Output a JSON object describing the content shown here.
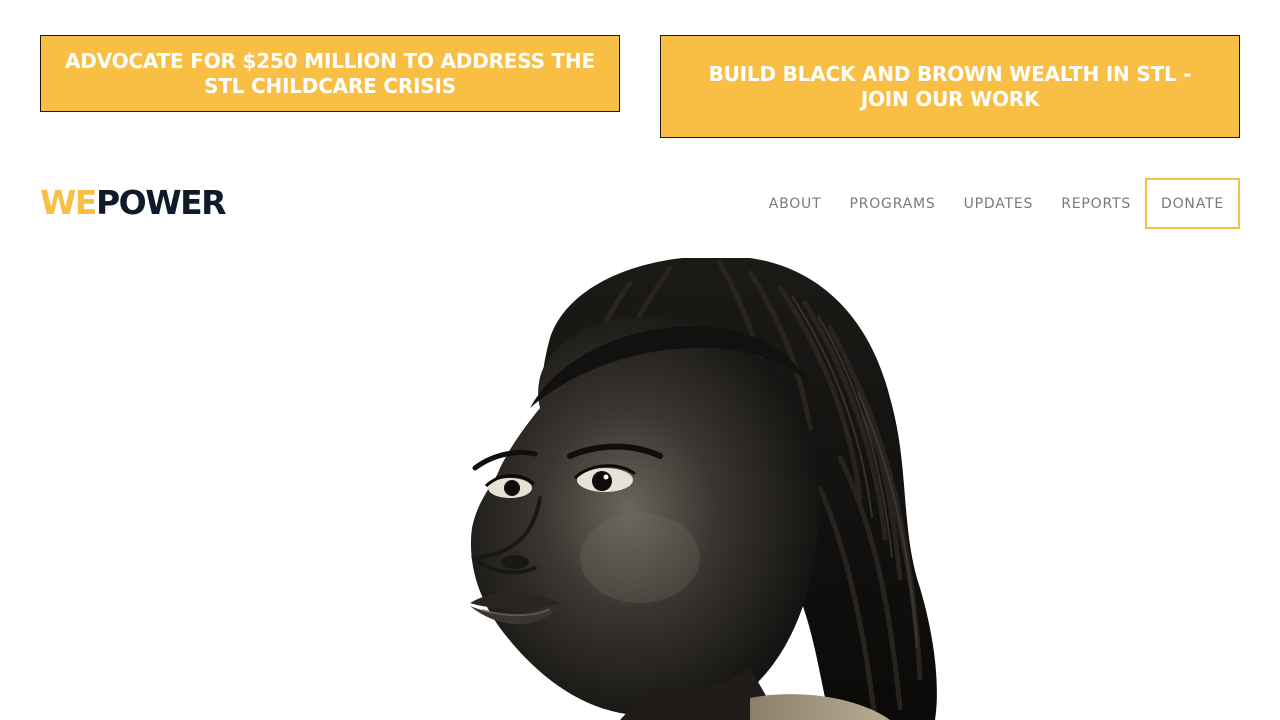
{
  "banners": [
    {
      "label": "ADVOCATE FOR $250 MILLION TO ADDRESS THE STL CHILDCARE CRISIS"
    },
    {
      "label": "BUILD BLACK AND BROWN WEALTH IN STL - JOIN OUR WORK"
    }
  ],
  "header": {
    "logo": {
      "part1": "WE",
      "part2": "POWER"
    },
    "nav": {
      "items": [
        {
          "label": "ABOUT"
        },
        {
          "label": "PROGRAMS"
        },
        {
          "label": "UPDATES"
        },
        {
          "label": "REPORTS"
        }
      ],
      "donate_label": "DONATE"
    }
  },
  "colors": {
    "accent_yellow": "#f9bf44",
    "logo_dark": "#0f1b2b",
    "nav_gray": "#7a7a7a"
  },
  "hero": {
    "image": "portrait-photo"
  }
}
